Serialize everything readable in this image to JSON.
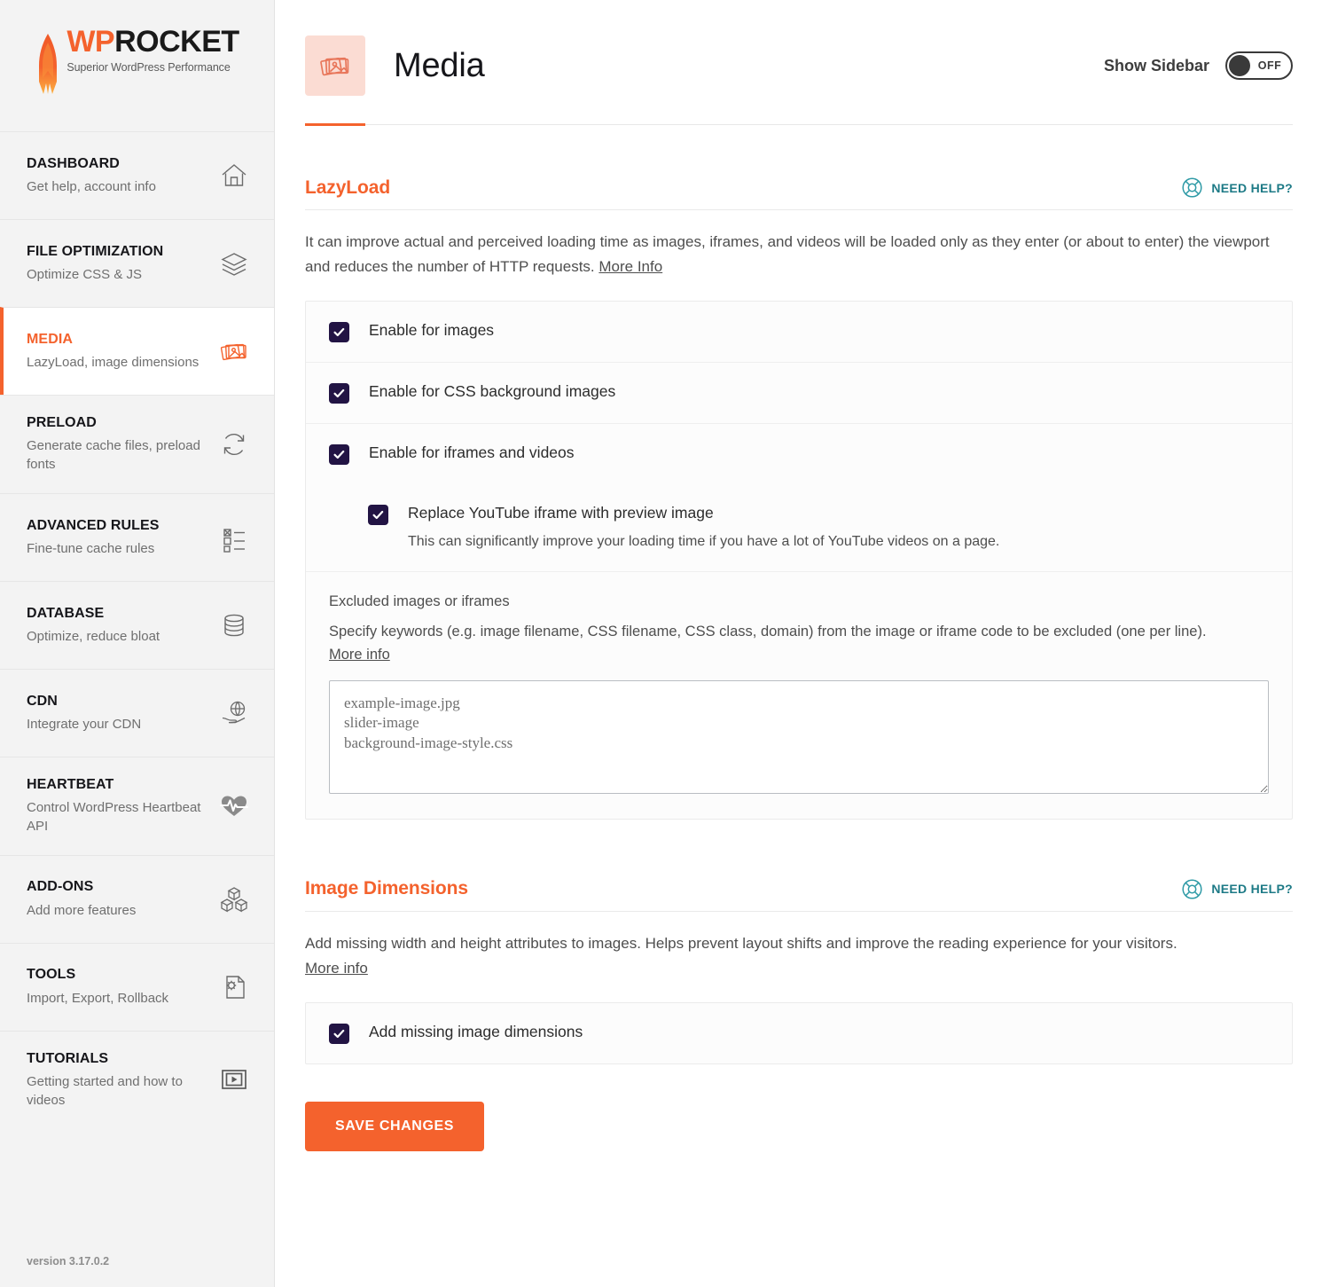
{
  "brand": {
    "logo_wp": "WP",
    "logo_rocket": "ROCKET",
    "tagline": "Superior WordPress Performance",
    "version": "version 3.17.0.2",
    "accent": "#f4622d",
    "teal": "#1d7a86",
    "checkbox_color": "#221444"
  },
  "sidebar": {
    "items": [
      {
        "title": "DASHBOARD",
        "desc": "Get help, account info",
        "icon": "home-icon",
        "active": false
      },
      {
        "title": "FILE OPTIMIZATION",
        "desc": "Optimize CSS & JS",
        "icon": "layers-icon",
        "active": false
      },
      {
        "title": "MEDIA",
        "desc": "LazyLoad, image dimensions",
        "icon": "photos-icon",
        "active": true
      },
      {
        "title": "PRELOAD",
        "desc": "Generate cache files, preload fonts",
        "icon": "refresh-icon",
        "active": false
      },
      {
        "title": "ADVANCED RULES",
        "desc": "Fine-tune cache rules",
        "icon": "checklist-icon",
        "active": false
      },
      {
        "title": "DATABASE",
        "desc": "Optimize, reduce bloat",
        "icon": "database-icon",
        "active": false
      },
      {
        "title": "CDN",
        "desc": "Integrate your CDN",
        "icon": "globe-hand-icon",
        "active": false
      },
      {
        "title": "HEARTBEAT",
        "desc": "Control WordPress Heartbeat API",
        "icon": "heartbeat-icon",
        "active": false
      },
      {
        "title": "ADD-ONS",
        "desc": "Add more features",
        "icon": "cubes-icon",
        "active": false
      },
      {
        "title": "TOOLS",
        "desc": "Import, Export, Rollback",
        "icon": "file-gear-icon",
        "active": false
      },
      {
        "title": "TUTORIALS",
        "desc": "Getting started and how to videos",
        "icon": "video-icon",
        "active": false
      }
    ]
  },
  "header": {
    "icon": "photos-icon",
    "title": "Media",
    "show_sidebar_label": "Show Sidebar",
    "toggle_state": "OFF"
  },
  "lazyload": {
    "title": "LazyLoad",
    "need_help": "NEED HELP?",
    "description": "It can improve actual and perceived loading time as images, iframes, and videos will be loaded only as they enter (or about to enter) the viewport and reduces the number of HTTP requests.",
    "more_info": "More Info",
    "options": [
      {
        "label": "Enable for images",
        "checked": true
      },
      {
        "label": "Enable for CSS background images",
        "checked": true
      },
      {
        "label": "Enable for iframes and videos",
        "checked": true
      }
    ],
    "suboption": {
      "label": "Replace YouTube iframe with preview image",
      "desc": "This can significantly improve your loading time if you have a lot of YouTube videos on a page.",
      "checked": true
    },
    "excluded": {
      "label": "Excluded images or iframes",
      "help": "Specify keywords (e.g. image filename, CSS filename, CSS class, domain) from the image or iframe code to be excluded (one per line).",
      "more_info": "More info",
      "placeholder": "example-image.jpg\nslider-image\nbackground-image-style.css",
      "value": ""
    }
  },
  "image_dimensions": {
    "title": "Image Dimensions",
    "need_help": "NEED HELP?",
    "description": "Add missing width and height attributes to images. Helps prevent layout shifts and improve the reading experience for your visitors.",
    "more_info": "More info",
    "option": {
      "label": "Add missing image dimensions",
      "checked": true
    }
  },
  "footer": {
    "save_label": "SAVE CHANGES"
  }
}
